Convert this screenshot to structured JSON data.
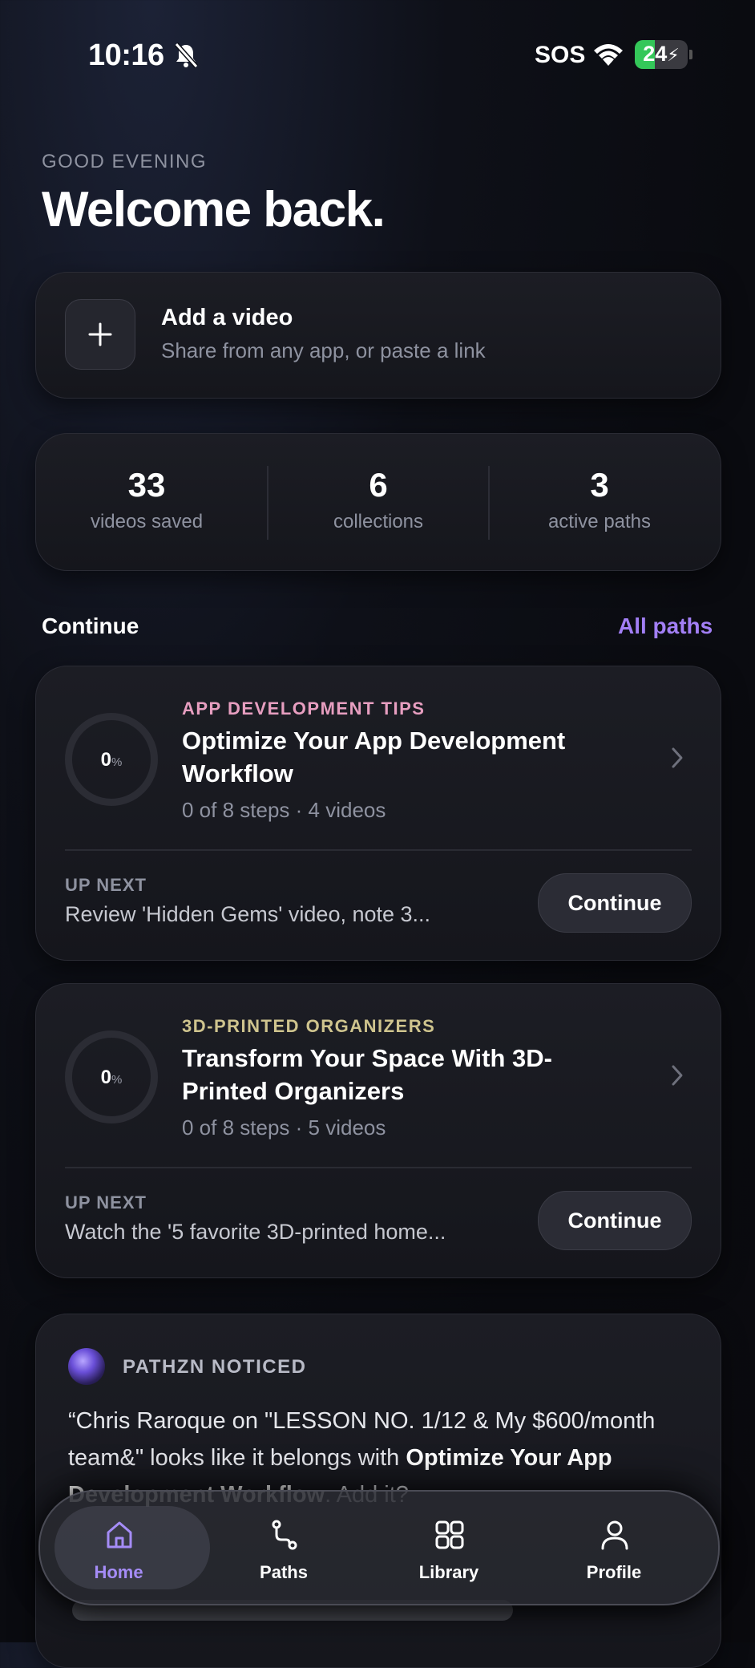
{
  "status_bar": {
    "time": "10:16",
    "carrier": "SOS",
    "battery": "24"
  },
  "header": {
    "greeting": "GOOD EVENING",
    "title": "Welcome back."
  },
  "add_video": {
    "title": "Add a video",
    "subtitle": "Share from any app, or paste a link"
  },
  "stats": [
    {
      "value": "33",
      "label": "videos saved"
    },
    {
      "value": "6",
      "label": "collections"
    },
    {
      "value": "3",
      "label": "active paths"
    }
  ],
  "continue_section": {
    "title": "Continue",
    "link": "All paths"
  },
  "paths": [
    {
      "category": "APP DEVELOPMENT TIPS",
      "category_color": "#e79ec0",
      "title": "Optimize Your App Development Workflow",
      "progress_value": "0",
      "progress_unit": "%",
      "meta": "0 of 8 steps · 4 videos",
      "up_next_label": "UP NEXT",
      "up_next": "Review 'Hidden Gems' video, note 3...",
      "button": "Continue"
    },
    {
      "category": "3D-PRINTED ORGANIZERS",
      "category_color": "#cfc48e",
      "title": "Transform Your Space With 3D-Printed Organizers",
      "progress_value": "0",
      "progress_unit": "%",
      "meta": "0 of 8 steps · 5 videos",
      "up_next_label": "UP NEXT",
      "up_next": "Watch the '5 favorite 3D-printed home...",
      "button": "Continue"
    }
  ],
  "noticed": {
    "title": "PATHZN NOTICED",
    "body_start": "“Chris Raroque on \"LESSON NO. 1/12 & My $600/month team&\" looks like it belongs with ",
    "body_path": "Optimize Your App Development Workflow",
    "body_end": ". Add it?"
  },
  "tabs": [
    {
      "label": "Home",
      "icon": "home-icon",
      "active": true
    },
    {
      "label": "Paths",
      "icon": "paths-icon",
      "active": false
    },
    {
      "label": "Library",
      "icon": "library-icon",
      "active": false
    },
    {
      "label": "Profile",
      "icon": "profile-icon",
      "active": false
    }
  ],
  "colors": {
    "accent": "#a27ff5"
  }
}
